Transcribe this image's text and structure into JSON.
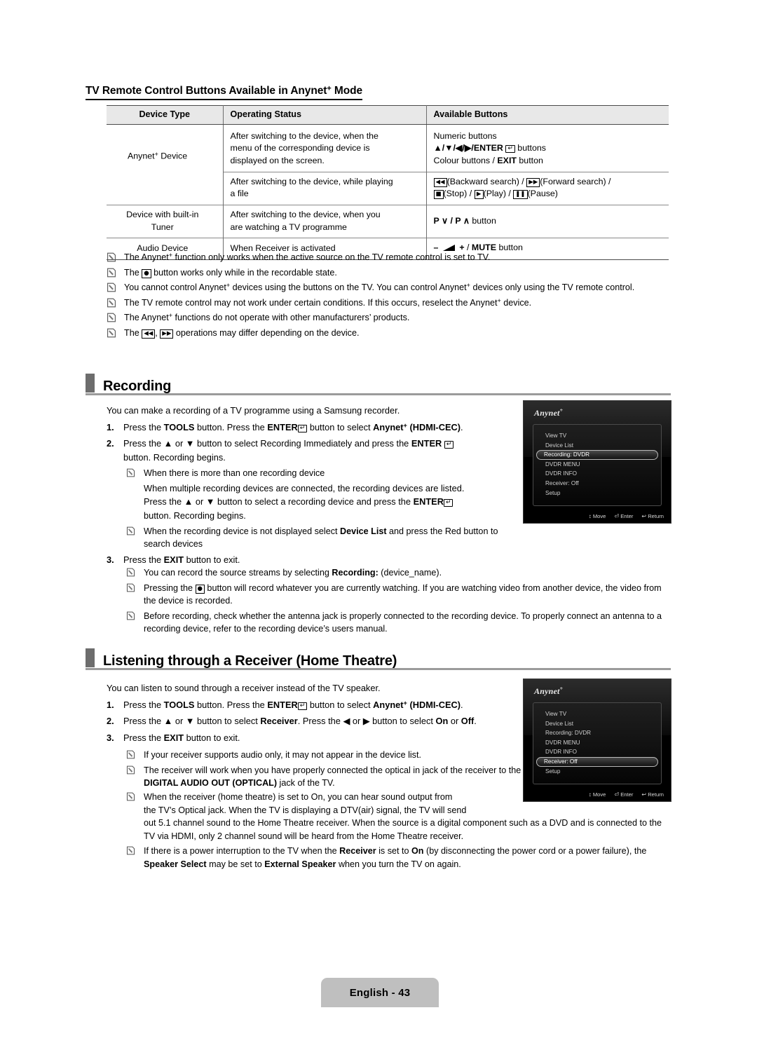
{
  "document": {
    "page_footer": "English - 43"
  },
  "section_table": {
    "heading": "TV Remote Control Buttons Available in Anynet+ Mode",
    "columns": [
      "Device Type",
      "Operating Status",
      "Available Buttons"
    ],
    "rows": [
      {
        "device_type": "Anynet+ Device",
        "operating_status": "After switching to the device, when the menu of the corresponding device is displayed on the screen.",
        "available_buttons_lines": [
          "Numeric buttons",
          "▲/▼/◀/▶/ENTER ↵ buttons",
          "Colour buttons / EXIT button"
        ]
      },
      {
        "device_type": "",
        "operating_status": "After switching to the device, while playing a file",
        "available_buttons_lines": [
          "◀◀(Backward search) / ▶▶(Forward search) /",
          "■(Stop) / ▶(Play) / ❚❚(Pause)"
        ]
      },
      {
        "device_type": "Device with built-in Tuner",
        "operating_status": "After switching to the device, when you are watching a TV programme",
        "available_buttons_lines": [
          "P ∨ / P ∧ button"
        ]
      },
      {
        "device_type": "Audio Device",
        "operating_status": "When Receiver is activated",
        "available_buttons_lines": [
          "– ◢ + / MUTE button"
        ]
      }
    ]
  },
  "table_notes": [
    "The Anynet+ function only works when the active source on the TV remote control is set to TV.",
    "The ● button works only while in the recordable state.",
    "You cannot control Anynet+ devices using the buttons on the TV. You can control Anynet+ devices only using the TV remote control.",
    "The TV remote control may not work under certain conditions. If this occurs, reselect the Anynet+ device.",
    "The Anynet+ functions do not operate with other manufacturers’ products.",
    "The ◀◀, ▶▶ operations may differ depending on the device."
  ],
  "recording": {
    "heading": "Recording",
    "intro": "You can make a recording of a TV programme using a Samsung recorder.",
    "steps": [
      {
        "num": "1.",
        "text": "Press the TOOLS button. Press the ENTER ↵ button to select Anynet+ (HDMI-CEC)."
      },
      {
        "num": "2.",
        "text": "Press the ▲ or ▼ button to select Recording Immediately and press the ENTER ↵ button. Recording begins."
      },
      {
        "num": "3.",
        "text": "Press the EXIT button to exit."
      }
    ],
    "sub_notes_step2": [
      "When there is more than one recording device",
      "When the recording device is not displayed select Device List and press the Red button to search devices"
    ],
    "sub_body_step2": "When multiple recording devices are connected, the recording devices are listed. Press the ▲ or ▼ button to select a recording device and press the ENTER ↵ button. Recording begins.",
    "after_notes": [
      "You can record the source streams by selecting Recording: (device_name).",
      "Pressing the ● button will record whatever you are currently watching. If you are watching video from another device, the video from the device is recorded.",
      "Before recording, check whether the antenna jack is properly connected to the recording device. To properly connect an antenna to a recording device, refer to the recording device’s users manual."
    ]
  },
  "receiver": {
    "heading": "Listening through a Receiver (Home Theatre)",
    "intro": "You can listen to sound through a receiver instead of the TV speaker.",
    "steps": [
      {
        "num": "1.",
        "text": "Press the TOOLS button. Press the ENTER ↵ button to select Anynet+ (HDMI-CEC)."
      },
      {
        "num": "2.",
        "text": "Press the ▲ or ▼ button to select Receiver. Press the ◀ or ▶ button to select On or Off."
      },
      {
        "num": "3.",
        "text": "Press the EXIT button to exit."
      }
    ],
    "notes": [
      "If your receiver supports audio only, it may not appear in the device list.",
      "The receiver will work when you have properly connected the optical in jack of the receiver to the DIGITAL AUDIO OUT (OPTICAL) jack of the TV.",
      "When the receiver (home theatre) is set to On, you can hear sound output from the TV’s Optical jack. When the TV is displaying a DTV(air) signal, the TV will send out 5.1 channel sound to the Home Theatre receiver. When the source is a digital component such as a DVD and is connected to the TV via HDMI, only 2 channel sound will be heard from the Home Theatre receiver.",
      "If there is a power interruption to the TV when the Receiver is set to On (by disconnecting the power cord or a power failure), the Speaker Select may be set to External Speaker when you turn the TV on again."
    ]
  },
  "tv_screens": [
    {
      "id": "recording-menu",
      "logo": "Anynet",
      "logo_sup": "+",
      "items": [
        "View TV",
        "Device List",
        "Recording: DVDR",
        "DVDR MENU",
        "DVDR INFO",
        "Receiver: Off",
        "Setup"
      ],
      "selected_index": 2,
      "hints": [
        "Move",
        "Enter",
        "Return"
      ]
    },
    {
      "id": "receiver-menu",
      "logo": "Anynet",
      "logo_sup": "+",
      "items": [
        "View TV",
        "Device List",
        "Recording: DVDR",
        "DVDR MENU",
        "DVDR INFO",
        "Receiver: Off",
        "Setup"
      ],
      "selected_index": 5,
      "hints": [
        "Move",
        "Enter",
        "Return"
      ]
    }
  ]
}
